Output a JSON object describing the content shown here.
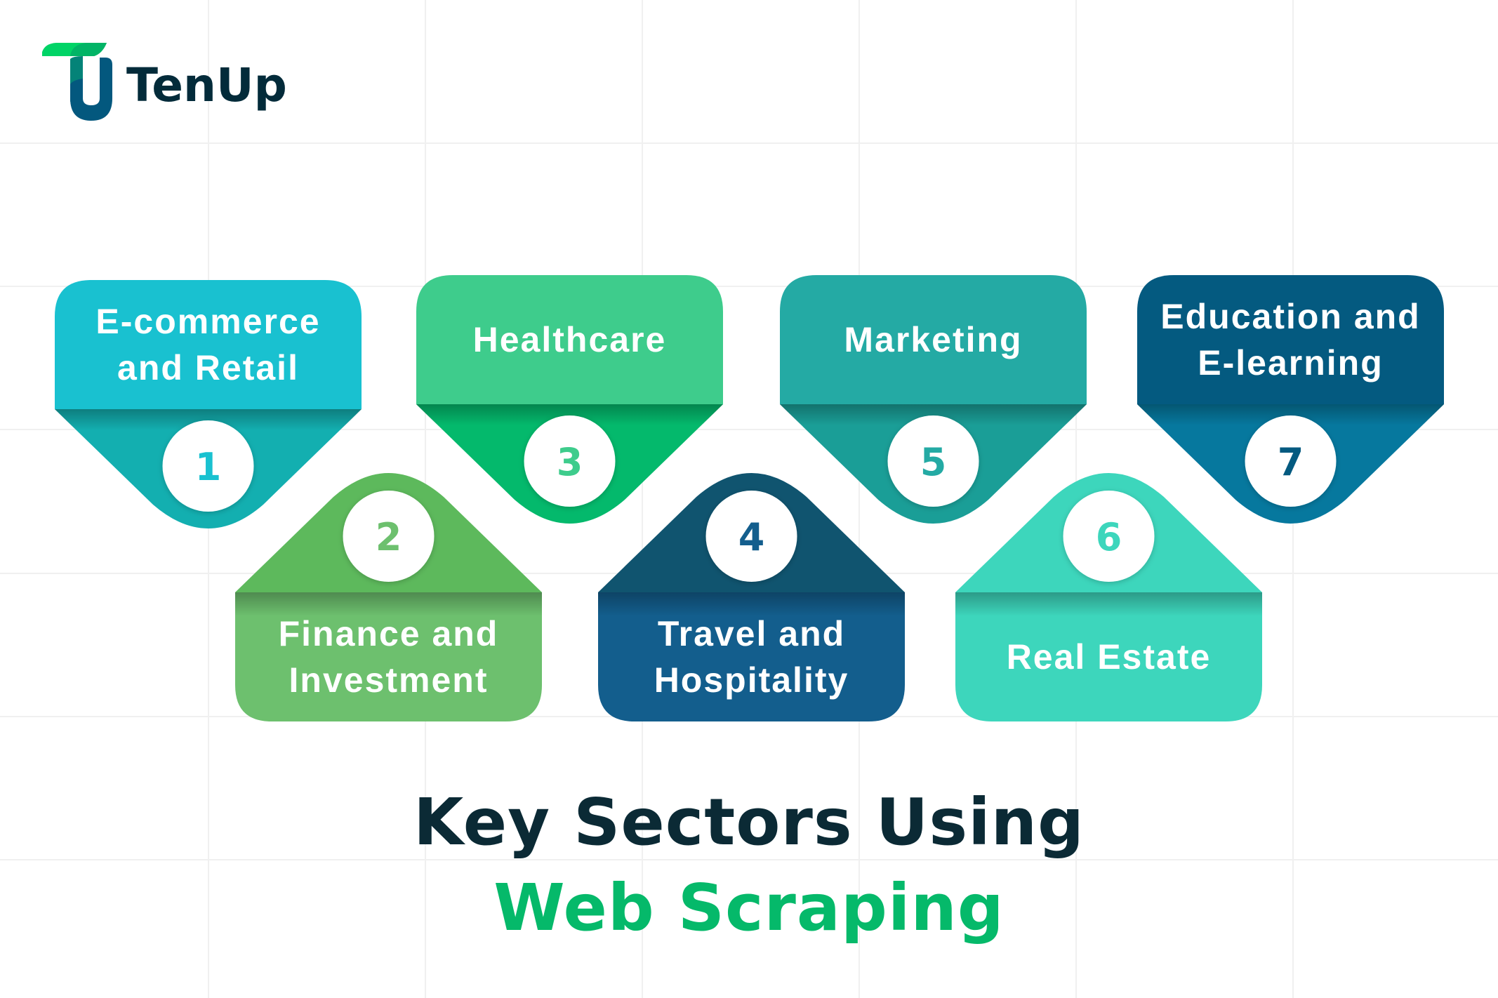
{
  "brand": {
    "name": "TenUp",
    "colors": {
      "green": "#00d466",
      "teal": "#048378",
      "blue": "#03587e",
      "text": "#032b3a"
    }
  },
  "sectors": [
    {
      "number": "1",
      "lines": [
        "E-commerce",
        "and Retail"
      ],
      "top_color": "#19c1d0",
      "tip_color": "#13afb0",
      "position": "top"
    },
    {
      "number": "2",
      "lines": [
        "Finance and",
        "Investment"
      ],
      "top_color": "#6dc06e",
      "tip_color": "#5db95c",
      "position": "bottom"
    },
    {
      "number": "3",
      "lines": [
        "Healthcare"
      ],
      "top_color": "#3ecc8c",
      "tip_color": "#04b96c",
      "position": "top"
    },
    {
      "number": "4",
      "lines": [
        "Travel and",
        "Hospitality"
      ],
      "top_color": "#135e8d",
      "tip_color": "#10546f",
      "position": "bottom"
    },
    {
      "number": "5",
      "lines": [
        "Marketing"
      ],
      "top_color": "#24aaa4",
      "tip_color": "#1a9e97",
      "position": "top"
    },
    {
      "number": "6",
      "lines": [
        "Real Estate"
      ],
      "top_color": "#3dd6bc",
      "tip_color": "#3dd6bc",
      "position": "bottom"
    },
    {
      "number": "7",
      "lines": [
        "Education and",
        "E-learning"
      ],
      "top_color": "#045a80",
      "tip_color": "#06789e",
      "position": "top"
    }
  ],
  "title": {
    "line1": "Key Sectors Using",
    "line2": "Web Scraping",
    "line1_color": "#0b2a35",
    "line2_color": "#05b96a"
  }
}
